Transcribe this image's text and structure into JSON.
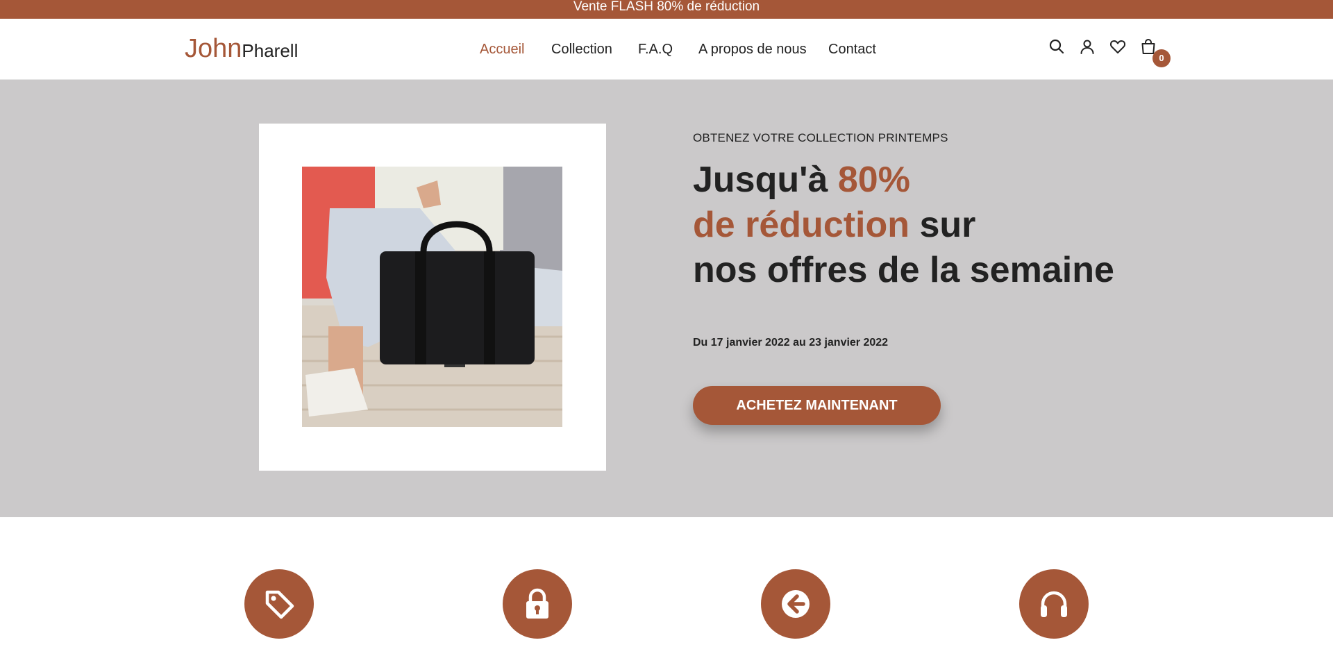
{
  "announcement": "Vente FLASH 80% de réduction",
  "logo": {
    "part1": "John",
    "part2": "Pharell"
  },
  "nav": [
    {
      "label": "Accueil",
      "active": true
    },
    {
      "label": "Collection"
    },
    {
      "label": "F.A.Q"
    },
    {
      "label": "A propos de nous"
    },
    {
      "label": "Contact"
    }
  ],
  "header_icons": [
    "search-icon",
    "user-icon",
    "heart-icon",
    "shopping-bag-icon"
  ],
  "cart_count": "0",
  "hero": {
    "eyebrow": "OBTENEZ VOTRE COLLECTION PRINTEMPS",
    "headline_part1": "Jusqu'à ",
    "headline_highlight1": "80%",
    "headline_highlight2": "de réduction",
    "headline_part2": " sur",
    "headline_line3": "nos offres de la semaine",
    "dates": "Du 17 janvier 2022 au 23 janvier 2022",
    "cta_label": "ACHETEZ MAINTENANT"
  },
  "features": [
    "tag-icon",
    "lock-icon",
    "return-arrow-icon",
    "headphones-icon"
  ],
  "colors": {
    "accent": "#a55738",
    "hero_bg": "#cbc9ca",
    "text": "#222222"
  }
}
